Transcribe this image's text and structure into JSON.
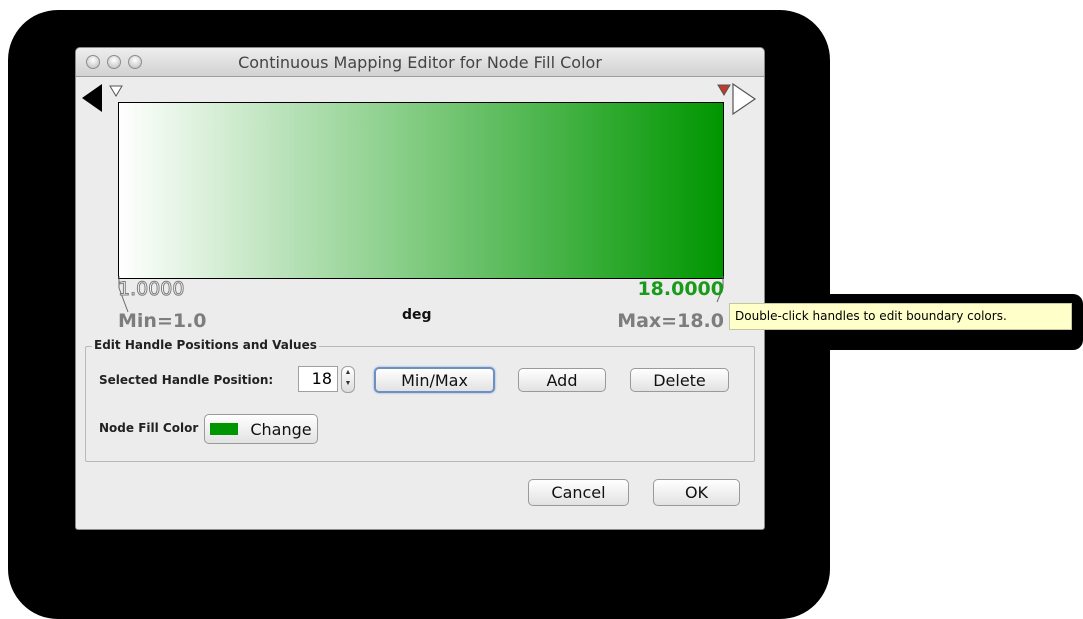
{
  "window": {
    "title": "Continuous Mapping Editor for Node Fill Color"
  },
  "gradient": {
    "start_color": "#ffffff",
    "end_color": "#009600"
  },
  "range": {
    "left_handle_value": "1.0000",
    "right_handle_value": "18.0000",
    "min_label": "Min=1.0",
    "max_label": "Max=18.0",
    "attribute": "deg"
  },
  "colors": {
    "selected_value": "#1a9a1a",
    "inactive_value": "#7d7d7d",
    "swatch": "#009600",
    "handle_selected": "#c0392b"
  },
  "edit_group": {
    "legend": "Edit Handle Positions and Values",
    "position_label": "Selected Handle Position:",
    "position_value": "18",
    "min_max_button": "Min/Max",
    "add_button": "Add",
    "delete_button": "Delete",
    "fill_label": "Node Fill Color",
    "change_button": "Change"
  },
  "dialog_buttons": {
    "cancel": "Cancel",
    "ok": "OK"
  },
  "tooltip": "Double-click handles to edit boundary colors."
}
